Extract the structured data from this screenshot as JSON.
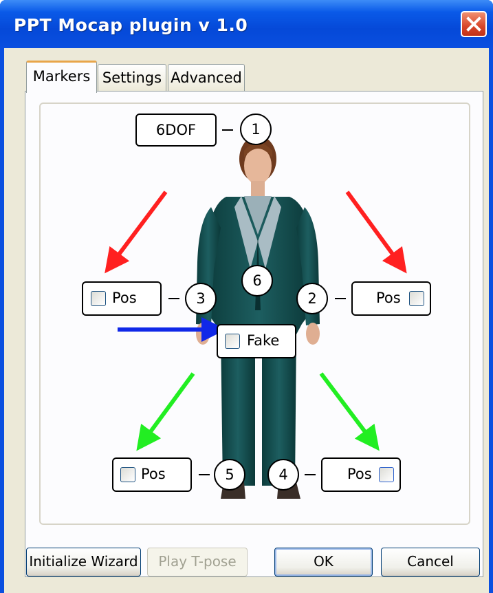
{
  "window": {
    "title": "PPT Mocap plugin v 1.0"
  },
  "tabs": [
    {
      "label": "Markers",
      "active": true
    },
    {
      "label": "Settings",
      "active": false
    },
    {
      "label": "Advanced",
      "active": false
    }
  ],
  "markers": {
    "head": {
      "box_label": "6DOF",
      "number": "1"
    },
    "right_hand": {
      "label": "Pos",
      "number": "3",
      "checked": false
    },
    "left_hand": {
      "label": "Pos",
      "number": "2",
      "checked": false
    },
    "torso": {
      "number": "6"
    },
    "fake": {
      "label": "Fake",
      "checked": false
    },
    "right_foot": {
      "label": "Pos",
      "number": "5",
      "checked": false
    },
    "left_foot": {
      "label": "Pos",
      "number": "4",
      "checked": false
    }
  },
  "arrows": {
    "red": "#ff2020",
    "blue": "#1028e8",
    "green": "#22ee22"
  },
  "buttons": {
    "initialize_wizard": "Initialize Wizard",
    "play_tpose": "Play T-pose",
    "ok": "OK",
    "cancel": "Cancel"
  }
}
